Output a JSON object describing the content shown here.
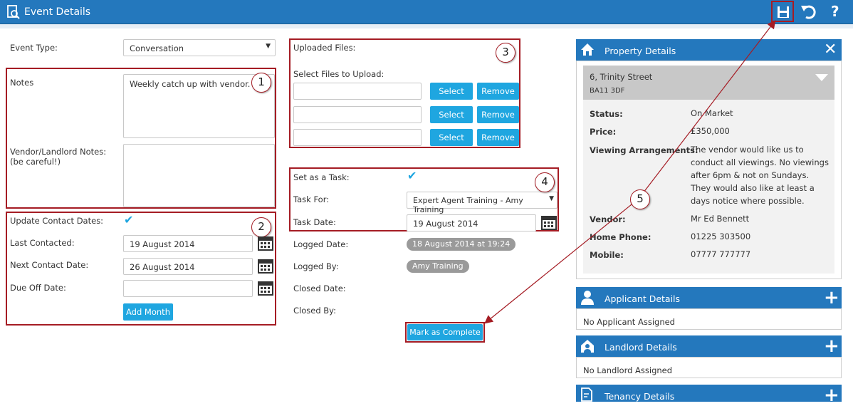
{
  "window": {
    "title": "Event Details"
  },
  "event_type": {
    "label": "Event Type:",
    "value": "Conversation"
  },
  "notes": {
    "label": "Notes",
    "value": "Weekly catch up with vendor."
  },
  "vendor_notes": {
    "label": "Vendor/Landlord Notes: (be careful!)",
    "value": ""
  },
  "contact": {
    "update_label": "Update Contact Dates:",
    "last_label": "Last Contacted:",
    "last_value": "19 August 2014",
    "next_label": "Next Contact Date:",
    "next_value": "26 August 2014",
    "due_label": "Due Off Date:",
    "due_value": "",
    "add_month": "Add Month"
  },
  "files": {
    "uploaded_label": "Uploaded Files:",
    "select_label": "Select Files to Upload:",
    "select_btn": "Select",
    "remove_btn": "Remove"
  },
  "task": {
    "set_label": "Set as a Task:",
    "for_label": "Task For:",
    "for_value": "Expert Agent Training - Amy Training",
    "date_label": "Task Date:",
    "date_value": "19 August 2014"
  },
  "logged": {
    "date_label": "Logged Date:",
    "date_value": "18 August 2014 at 19:24",
    "by_label": "Logged By:",
    "by_value": "Amy Training",
    "closed_date_label": "Closed Date:",
    "closed_by_label": "Closed By:"
  },
  "mark_complete": "Mark as Complete",
  "callouts": [
    "1",
    "2",
    "3",
    "4",
    "5"
  ],
  "property": {
    "title": "Property Details",
    "address1": "6, Trinity Street",
    "address2": "BA11 3DF",
    "status_label": "Status:",
    "status_value": "On Market",
    "price_label": "Price:",
    "price_value": "£350,000",
    "viewing_label": "Viewing Arrangements:",
    "viewing_value": "The vendor would like us to conduct all viewings. No viewings after 6pm & not on Sundays. They would also like at least a days notice where possible.",
    "vendor_label": "Vendor:",
    "vendor_value": "Mr Ed Bennett",
    "home_label": "Home Phone:",
    "home_value": "01225 303500",
    "mobile_label": "Mobile:",
    "mobile_value": "07777 777777"
  },
  "applicant": {
    "title": "Applicant Details",
    "body": "No Applicant Assigned"
  },
  "landlord": {
    "title": "Landlord Details",
    "body": "No Landlord Assigned"
  },
  "tenancy": {
    "title": "Tenancy Details"
  },
  "colors": {
    "accent": "#2478bd",
    "button": "#1fa6e0",
    "annotation": "#a51c24"
  }
}
